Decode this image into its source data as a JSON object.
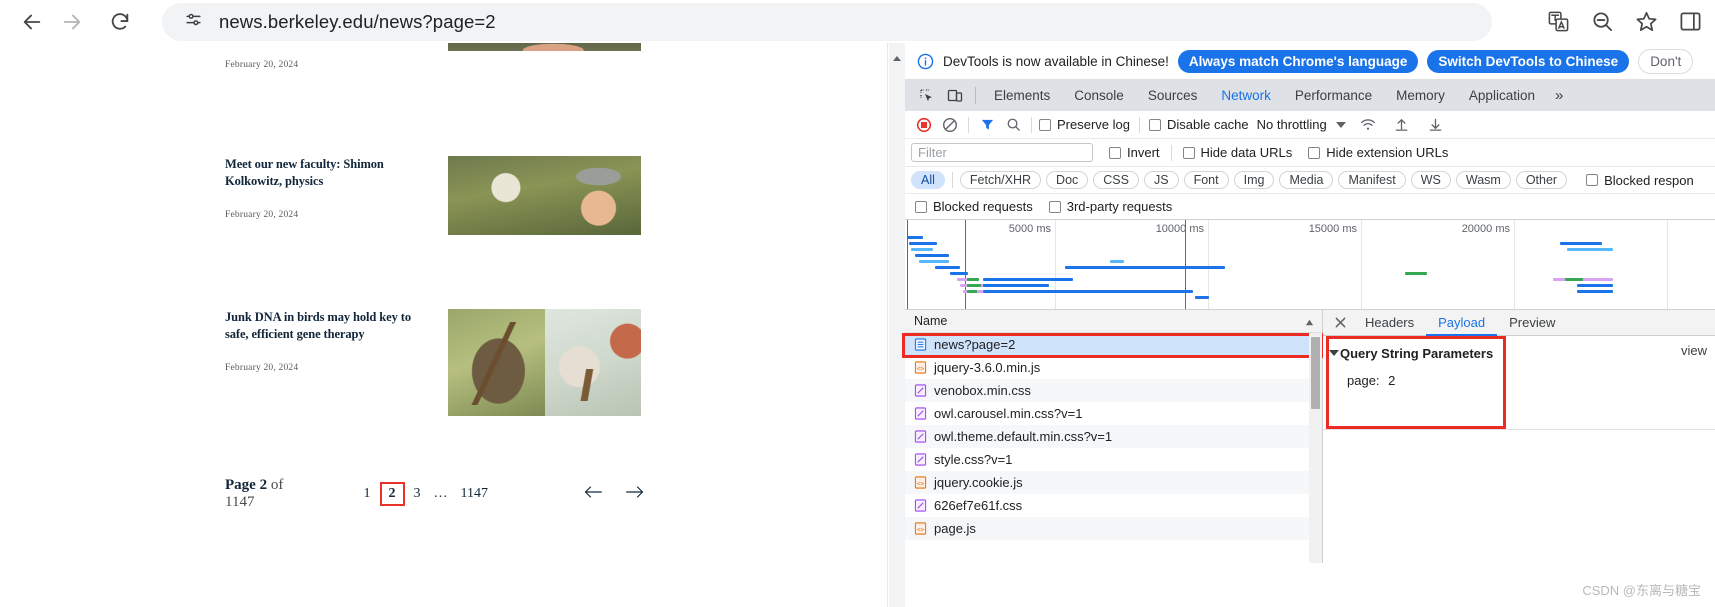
{
  "browser": {
    "back_icon": "arrow-left-icon",
    "forward_icon": "arrow-right-icon",
    "reload_icon": "reload-icon",
    "site_info_icon": "tune-icon",
    "url": "news.berkeley.edu/news?page=2",
    "actions": [
      {
        "name": "translate-icon"
      },
      {
        "name": "zoom-icon"
      },
      {
        "name": "bookmark-star-icon"
      },
      {
        "name": "side-panel-icon"
      }
    ]
  },
  "webpage": {
    "articles": [
      {
        "title": "",
        "date": "February 20, 2024",
        "thumb": "portrait-photo"
      },
      {
        "title": "Meet our new faculty: Shimon Kolkowitz, physics",
        "date": "February 20, 2024",
        "thumb": "man-in-cal-cap-photo"
      },
      {
        "title": "Junk DNA in birds may hold key to safe, efficient gene therapy",
        "date": "February 20, 2024",
        "thumb": "two-birds-photo"
      }
    ],
    "pagination": {
      "label_prefix": "Page",
      "current": "2",
      "of": "of",
      "total": "1147",
      "numbers": [
        "1",
        "2",
        "3",
        "…",
        "1147"
      ],
      "active_number": "2",
      "prev_icon": "arrow-left-icon",
      "next_icon": "arrow-right-icon"
    }
  },
  "devtools": {
    "banner": {
      "icon": "info-icon",
      "message": "DevTools is now available in Chinese!",
      "primary_button": "Always match Chrome's language",
      "secondary_button": "Switch DevTools to Chinese",
      "tertiary_button": "Don't"
    },
    "tabs": {
      "inspect_icon": "inspect-element-icon",
      "device_icon": "device-toolbar-icon",
      "items": [
        "Elements",
        "Console",
        "Sources",
        "Network",
        "Performance",
        "Memory",
        "Application"
      ],
      "active": "Network",
      "overflow": "»"
    },
    "network_toolbar": {
      "record_icon": "record-stop-icon",
      "clear_icon": "clear-icon",
      "filter_icon": "filter-icon",
      "search_icon": "search-icon",
      "preserve_log": "Preserve log",
      "disable_cache": "Disable cache",
      "throttling": "No throttling",
      "wifi_icon": "wifi-icon",
      "import_icon": "import-har-icon",
      "export_icon": "export-har-icon"
    },
    "filter_bar": {
      "filter_placeholder": "Filter",
      "invert": "Invert",
      "hide_data_urls": "Hide data URLs",
      "hide_extension_urls": "Hide extension URLs"
    },
    "type_filters": {
      "items": [
        "All",
        "Fetch/XHR",
        "Doc",
        "CSS",
        "JS",
        "Font",
        "Img",
        "Media",
        "Manifest",
        "WS",
        "Wasm",
        "Other"
      ],
      "active": "All",
      "blocked_responses": "Blocked respon"
    },
    "option_bar": {
      "blocked_requests": "Blocked requests",
      "third_party_requests": "3rd-party requests"
    },
    "overview": {
      "ticks": [
        "5000 ms",
        "10000 ms",
        "15000 ms",
        "20000 ms"
      ]
    },
    "request_table": {
      "column_header": "Name",
      "rows": [
        {
          "name": "news?page=2",
          "type": "doc",
          "selected": true
        },
        {
          "name": "jquery-3.6.0.min.js",
          "type": "js",
          "selected": false
        },
        {
          "name": "venobox.min.css",
          "type": "css",
          "selected": false
        },
        {
          "name": "owl.carousel.min.css?v=1",
          "type": "css",
          "selected": false
        },
        {
          "name": "owl.theme.default.min.css?v=1",
          "type": "css",
          "selected": false
        },
        {
          "name": "style.css?v=1",
          "type": "css",
          "selected": false
        },
        {
          "name": "jquery.cookie.js",
          "type": "js",
          "selected": false
        },
        {
          "name": "626ef7e61f.css",
          "type": "css",
          "selected": false
        },
        {
          "name": "page.js",
          "type": "js",
          "selected": false
        }
      ]
    },
    "detail_pane": {
      "close_icon": "close-icon",
      "tabs": [
        "Headers",
        "Payload",
        "Preview"
      ],
      "active_tab": "Payload",
      "section_title": "Query String Parameters",
      "view_link": "view",
      "parameters": [
        {
          "name": "page:",
          "value": "2"
        }
      ]
    }
  },
  "watermark": "CSDN @东离与糖宝",
  "colors": {
    "accent_blue": "#1a73e8",
    "highlight_red": "#ee2b22",
    "selected_row": "#cfe3fb",
    "tabbar_bg": "#dee1e6"
  }
}
